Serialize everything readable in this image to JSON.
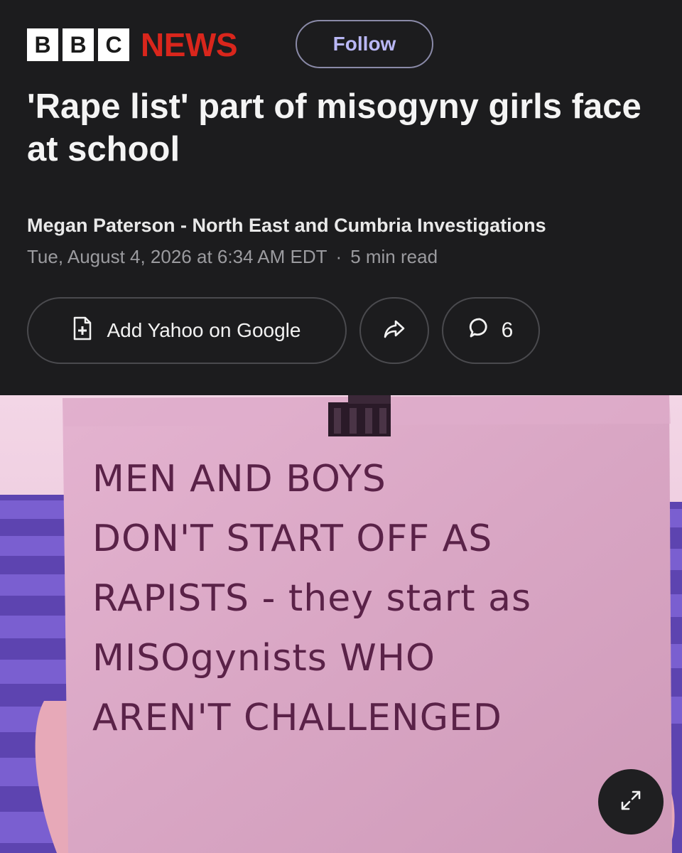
{
  "header": {
    "brand_letters": [
      "B",
      "B",
      "C"
    ],
    "brand_news": "NEWS",
    "follow_label": "Follow"
  },
  "article": {
    "headline": "'Rape list' part of misogyny girls face at school",
    "byline": "Megan Paterson - North East and Cumbria Investigations",
    "date": "Tue, August 4, 2026 at 6:34 AM EDT",
    "read_time": "5 min read"
  },
  "actions": {
    "add_label": "Add Yahoo on Google",
    "comment_count": "6"
  },
  "image": {
    "sign_lines": [
      "MEN AND BOYS",
      "DON'T START OFF AS",
      "RAPISTS - they start as",
      "MISOgynists WHO",
      "AREN'T CHALLENGED"
    ]
  },
  "icons": {
    "add": "add-document-icon",
    "share": "share-arrow-icon",
    "comment": "comment-bubble-icon",
    "expand": "expand-icon"
  },
  "colors": {
    "background": "#1c1c1e",
    "news_red": "#d9261c",
    "follow_text": "#b9b7f5",
    "cardboard": "#dba8c8",
    "seats": "#6a4fc0"
  }
}
